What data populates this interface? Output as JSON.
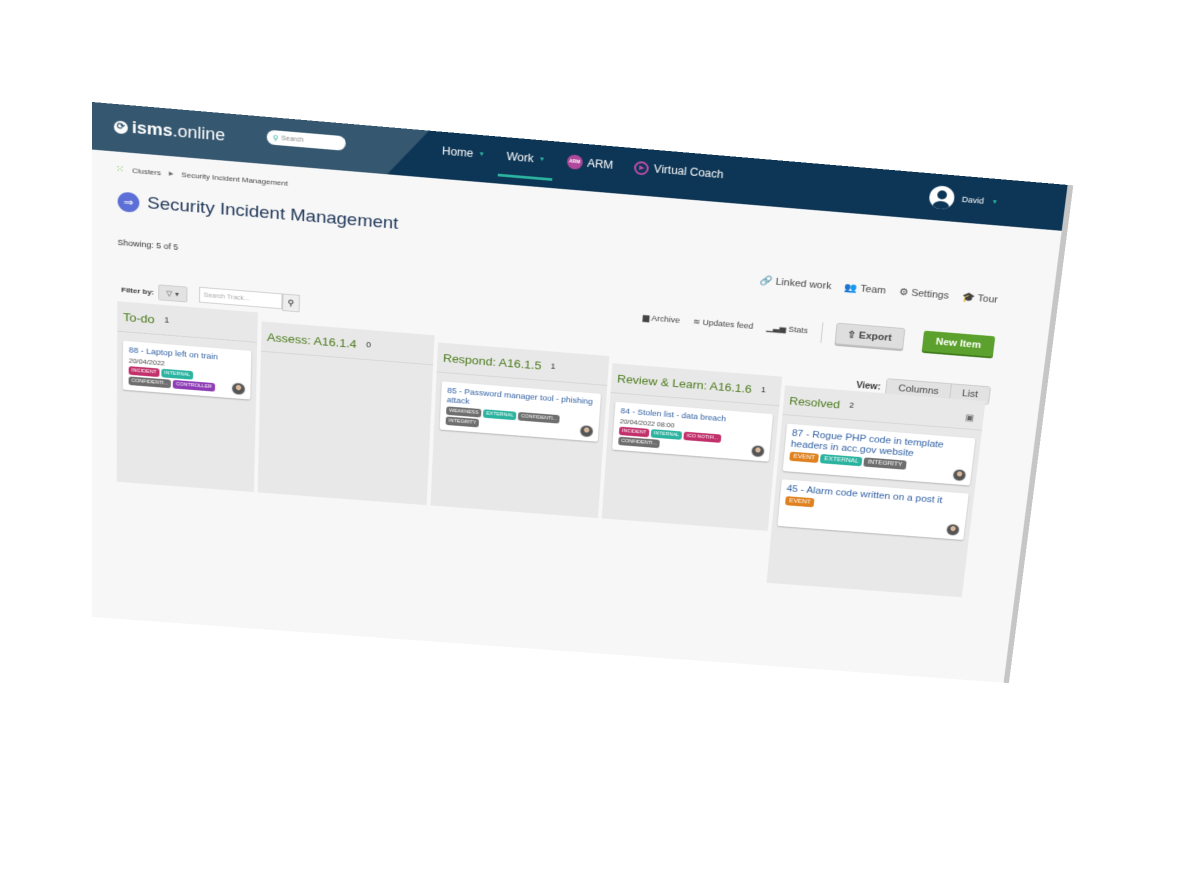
{
  "app": {
    "logo_text_bold": "isms",
    "logo_text_rest": ".online",
    "search_placeholder": "Search"
  },
  "nav": {
    "items": [
      {
        "label": "Home",
        "has_caret": true,
        "active": false
      },
      {
        "label": "Work",
        "has_caret": true,
        "active": true
      },
      {
        "label": "ARM",
        "badge": "ARM"
      },
      {
        "label": "Virtual Coach"
      }
    ]
  },
  "user": {
    "name": "David"
  },
  "breadcrumb": {
    "root": "Clusters",
    "current": "Security Incident Management"
  },
  "page": {
    "title": "Security Incident Management",
    "showing": "Showing: 5 of 5"
  },
  "toplinks": [
    {
      "icon": "link-icon",
      "glyph": "🔗",
      "label": "Linked work"
    },
    {
      "icon": "team-icon",
      "glyph": "👥",
      "label": "Team"
    },
    {
      "icon": "gear-icon",
      "glyph": "⚙",
      "label": "Settings"
    },
    {
      "icon": "graduation-cap-icon",
      "glyph": "🎓",
      "label": "Tour"
    }
  ],
  "filter": {
    "label": "Filter by:",
    "search_placeholder": "Search Track..."
  },
  "actions": {
    "archive": "Archive",
    "updates_feed": "Updates feed",
    "stats": "Stats",
    "export": "Export",
    "new_item": "New Item"
  },
  "view": {
    "label": "View:",
    "options": [
      "Columns",
      "List"
    ],
    "selected": "Columns"
  },
  "colors": {
    "navbar": "#0d3555",
    "accent_teal": "#2bb3a0",
    "column_title_green": "#4a7a1a",
    "new_item_green": "#5ca12d",
    "card_title_blue": "#2f5fa3"
  },
  "tag_colors": {
    "INCIDENT": "#c2306b",
    "INTERNAL": "#2bb3a0",
    "CONFIDENTI...": "#6e6e6e",
    "CONTROLLER": "#8e3cb5",
    "WEAKNESS": "#6e6e6e",
    "EXTERNAL": "#2bb3a0",
    "INTEGRITY": "#6e6e6e",
    "ICO NOTIFI...": "#c2306b",
    "EVENT": "#e0811f"
  },
  "columns": [
    {
      "name": "To-do",
      "count": "1",
      "cards": [
        {
          "title": "88 - Laptop left on train",
          "date": "20/04/2022",
          "tags": [
            "INCIDENT",
            "INTERNAL",
            "CONFIDENTI...",
            "CONTROLLER"
          ]
        }
      ]
    },
    {
      "name": "Assess: A16.1.4",
      "count": "0",
      "cards": []
    },
    {
      "name": "Respond: A16.1.5",
      "count": "1",
      "cards": [
        {
          "title": "85 - Password manager tool - phishing attack",
          "date": "",
          "tags": [
            "WEAKNESS",
            "EXTERNAL",
            "CONFIDENTI...",
            "INTEGRITY"
          ]
        }
      ]
    },
    {
      "name": "Review & Learn: A16.1.6",
      "count": "1",
      "cards": [
        {
          "title": "84 - Stolen list - data breach",
          "date": "20/04/2022 08:00",
          "tags": [
            "INCIDENT",
            "INTERNAL",
            "ICO NOTIFI...",
            "CONFIDENTI..."
          ]
        }
      ]
    },
    {
      "name": "Resolved",
      "count": "2",
      "cards": [
        {
          "title": "87 - Rogue PHP code in template headers in acc.gov website",
          "date": "",
          "tags": [
            "EVENT",
            "EXTERNAL",
            "INTEGRITY"
          ]
        },
        {
          "title": "45 - Alarm code written on a post it",
          "date": "",
          "tags": [
            "EVENT"
          ]
        }
      ]
    }
  ]
}
